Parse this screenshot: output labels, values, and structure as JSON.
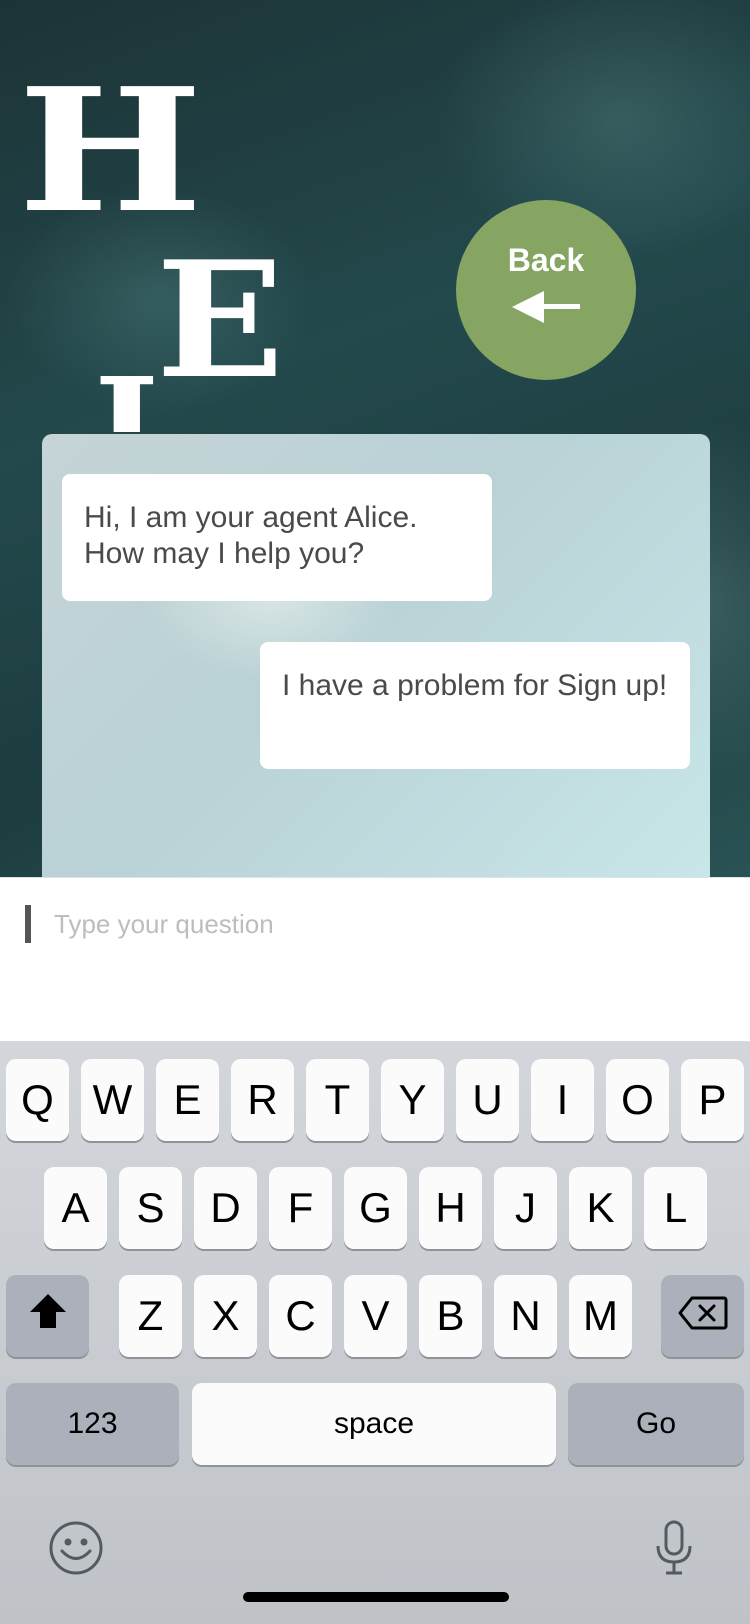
{
  "header": {
    "letters": [
      "H",
      "E",
      "I"
    ],
    "back_label": "Back"
  },
  "chat": {
    "messages": [
      {
        "from": "agent",
        "text": "Hi, I am your agent Alice. How may I help you?"
      },
      {
        "from": "user",
        "text": "I have a problem for Sign up!"
      }
    ]
  },
  "input": {
    "placeholder": "Type your question",
    "value": ""
  },
  "keyboard": {
    "row1": [
      "Q",
      "W",
      "E",
      "R",
      "T",
      "Y",
      "U",
      "I",
      "O",
      "P"
    ],
    "row2": [
      "A",
      "S",
      "D",
      "F",
      "G",
      "H",
      "J",
      "K",
      "L"
    ],
    "row3": [
      "Z",
      "X",
      "C",
      "V",
      "B",
      "N",
      "M"
    ],
    "numbers_label": "123",
    "space_label": "space",
    "go_label": "Go",
    "icons": [
      "shift-icon",
      "backspace-icon",
      "emoji-icon",
      "microphone-icon"
    ]
  },
  "colors": {
    "back_button": "#86a563",
    "key_light": "#fbfbfc",
    "key_dark": "#abb0ba"
  }
}
